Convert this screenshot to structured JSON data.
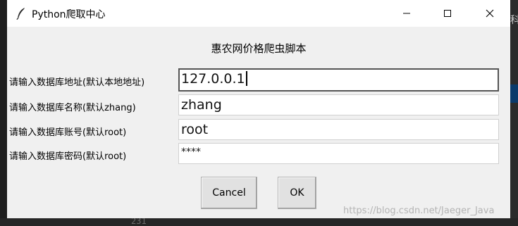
{
  "window": {
    "title": "Python爬取中心",
    "controls": {
      "minimize_icon": "minimize-icon",
      "maximize_icon": "maximize-icon",
      "close_icon": "close-icon"
    }
  },
  "form": {
    "heading": "惠农网价格爬虫脚本",
    "fields": [
      {
        "label": "请输入数据库地址(默认本地地址)",
        "value": "127.0.0.1",
        "focused": true
      },
      {
        "label": "请输入数据库名称(默认zhang)",
        "value": "zhang"
      },
      {
        "label": "请输入数据库账号(默认root)",
        "value": "root"
      },
      {
        "label": "请输入数据库密码(默认root)",
        "value": "****"
      }
    ],
    "buttons": {
      "cancel": "Cancel",
      "ok": "OK"
    }
  },
  "background": {
    "line_number": "231",
    "right_edge_text": "科"
  },
  "watermark": "https://blog.csdn.net/Jaeger_Java"
}
